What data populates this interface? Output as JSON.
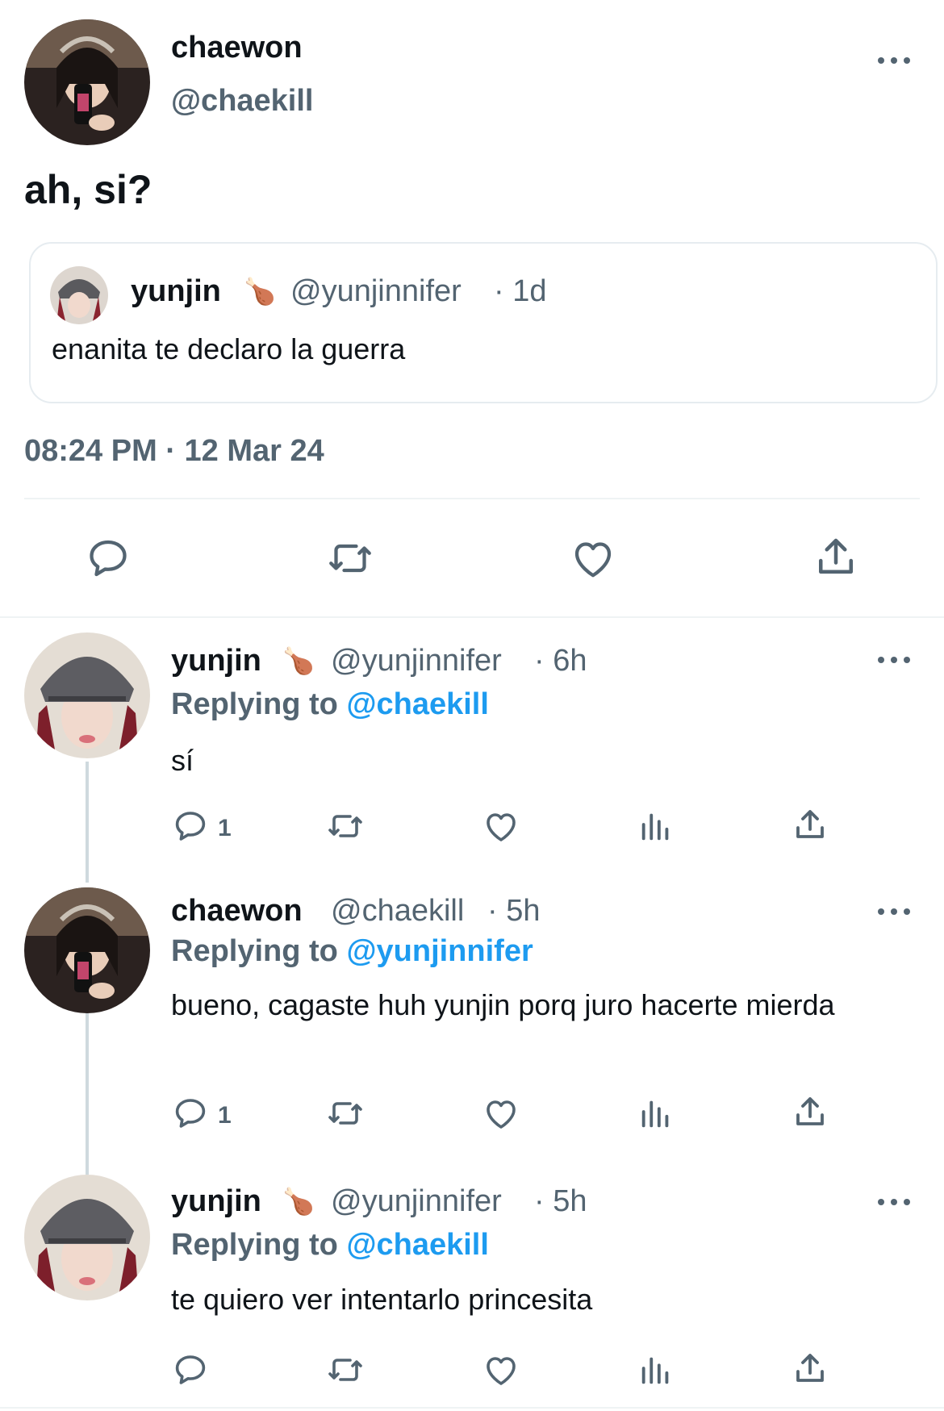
{
  "main_tweet": {
    "display_name": "chaewon",
    "handle": "@chaekill",
    "text": "ah, si?",
    "timestamp": "08:24 PM · 12 Mar 24",
    "quoted": {
      "display_name": "yunjin",
      "emoji": "🍗",
      "handle": "@yunjinnifer",
      "time": "· 1d",
      "text": "enanita te declaro la guerra"
    }
  },
  "replies": [
    {
      "display_name": "yunjin",
      "emoji": "🍗",
      "handle": "@yunjinnifer",
      "time": "· 6h",
      "replying_prefix": "Replying to",
      "replying_to": "@chaekill",
      "text": "sí",
      "reply_count": "1"
    },
    {
      "display_name": "chaewon",
      "handle": "@chaekill",
      "time": "· 5h",
      "replying_prefix": "Replying to",
      "replying_to": "@yunjinnifer",
      "text": "bueno, cagaste huh yunjin porq juro hacerte mierda",
      "reply_count": "1"
    },
    {
      "display_name": "yunjin",
      "emoji": "🍗",
      "handle": "@yunjinnifer",
      "time": "· 5h",
      "replying_prefix": "Replying to",
      "replying_to": "@chaekill",
      "text": "te quiero ver intentarlo princesita",
      "reply_count": ""
    }
  ],
  "colors": {
    "text": "#0f1419",
    "secondary": "#536471",
    "accent": "#1d9bf0",
    "divider": "#eff3f4"
  },
  "icons": [
    "more-icon",
    "reply-icon",
    "retweet-icon",
    "like-icon",
    "views-icon",
    "share-icon"
  ]
}
